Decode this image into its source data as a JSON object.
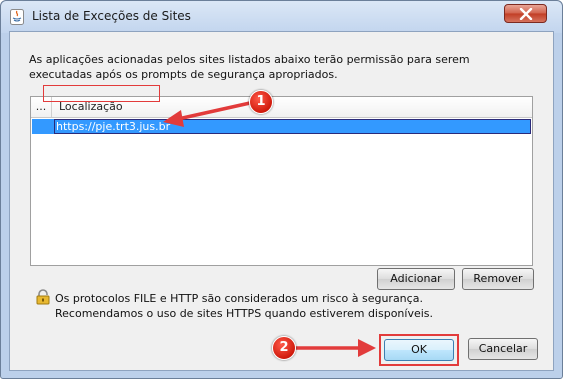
{
  "window": {
    "title": "Lista de Exceções de Sites"
  },
  "description": "As aplicações acionadas pelos sites listados abaixo terão permissão para serem executadas após os prompts de segurança apropriados.",
  "table": {
    "columns": [
      "...",
      "Localização"
    ],
    "rows": [
      {
        "location": "https://pje.trt3.jus.br",
        "selected": true
      }
    ]
  },
  "buttons": {
    "add": "Adicionar",
    "remove": "Remover",
    "ok": "OK",
    "cancel": "Cancelar"
  },
  "warning": {
    "line1": "Os protocolos FILE e HTTP são considerados um risco à segurança.",
    "line2": "Recomendamos o uso de sites HTTPS quando estiverem disponíveis."
  },
  "annotations": {
    "step1": "1",
    "step2": "2",
    "color": "#e23b3b"
  }
}
